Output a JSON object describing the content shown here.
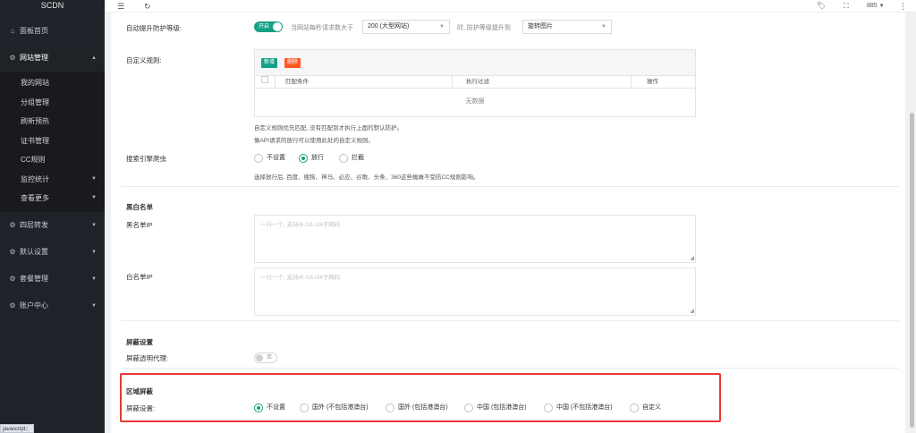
{
  "sidebar": {
    "brand": "SCDN",
    "items": [
      {
        "label": "面板首页",
        "icon": "home-icon"
      },
      {
        "label": "网站管理",
        "icon": "gear-icon",
        "active": true
      },
      {
        "label": "四层转发",
        "icon": "gear-icon"
      },
      {
        "label": "默认设置",
        "icon": "gear-icon"
      },
      {
        "label": "套餐管理",
        "icon": "gear-icon"
      },
      {
        "label": "账户中心",
        "icon": "gear-icon"
      }
    ],
    "submenu": [
      "我的网站",
      "分组管理",
      "刷新预热",
      "证书管理",
      "CC规则",
      "监控统计",
      "查看更多"
    ]
  },
  "statusbar": "javascript:;",
  "topbar": {
    "number": "885"
  },
  "auto_upgrade": {
    "label": "自动提升防护等级:",
    "switch_label": "开启",
    "text1": "当网站每秒请求数大于",
    "select_value": "200 (大型网站)",
    "text2": "时, 防护等级提升到",
    "select2_value": "旋转图片"
  },
  "custom_rules": {
    "label": "自定义规则:",
    "add_label": "新增",
    "delete_label": "删除",
    "col_match": "匹配条件",
    "col_action": "执行过滤",
    "col_op": "操作",
    "empty": "无数据",
    "help1": "自定义规则优先匹配, 没有匹配到才执行上面的默认防护。",
    "help2": "像API请求的放行可以使用此处的自定义规则。"
  },
  "spider": {
    "label": "搜索引擎爬虫",
    "options": [
      "不设置",
      "放行",
      "拦截"
    ],
    "selected": 1,
    "help": "选择放行后, 百度、搜狗、神马、必应、谷歌、头条、360这些蜘蛛不受防CC规则影响。"
  },
  "bw": {
    "title": "黑白名单",
    "black_label": "黑名单IP",
    "black_placeholder": "一行一个, 支持/8 /16 /24子网码",
    "white_label": "白名单IP",
    "white_placeholder": "一行一个, 支持/8 /16 /24子网码"
  },
  "shield": {
    "title": "屏蔽设置",
    "proxy_label": "屏蔽透明代理:",
    "proxy_switch": "否"
  },
  "region": {
    "title": "区域屏蔽",
    "label": "屏蔽设置:",
    "options": [
      "不设置",
      "国外 (不包括港澳台)",
      "国外 (包括港澳台)",
      "中国 (包括港澳台)",
      "中国 (不包括港澳台)",
      "自定义"
    ],
    "selected": 0
  }
}
